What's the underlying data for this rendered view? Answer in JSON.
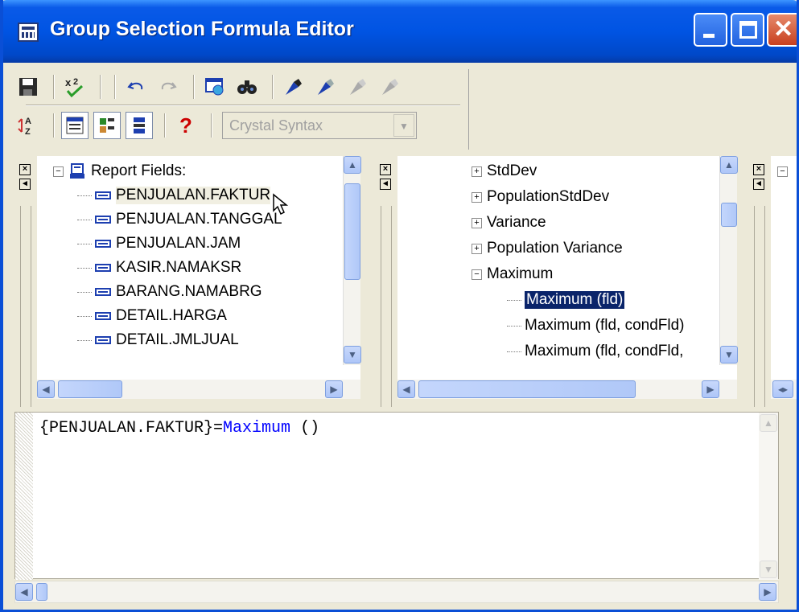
{
  "window": {
    "title": "Group Selection Formula Editor",
    "min_label": "",
    "max_label": "",
    "close_label": "✕"
  },
  "toolbar": {
    "syntax_combo": "Crystal Syntax",
    "icons": [
      "save-icon",
      "check-syntax-icon",
      "undo-icon",
      "redo-icon",
      "browse-data-icon",
      "find-icon",
      "bookmark-icon",
      "next-bookmark-icon",
      "prev-bookmark-icon",
      "clear-bookmarks-icon",
      "sort-az-icon",
      "field-tree-icon",
      "function-tree-icon",
      "operator-tree-icon",
      "help-icon"
    ]
  },
  "fields_tree": {
    "root": "Report Fields:",
    "items": [
      "PENJUALAN.FAKTUR",
      "PENJUALAN.TANGGAL",
      "PENJUALAN.JAM",
      "KASIR.NAMAKSR",
      "BARANG.NAMABRG",
      "DETAIL.HARGA",
      "DETAIL.JMLJUAL"
    ]
  },
  "functions_tree": {
    "items": [
      "StdDev",
      "PopulationStdDev",
      "Variance",
      "Population Variance",
      "Maximum"
    ],
    "children": [
      "Maximum (fld)",
      "Maximum (fld, condFld)",
      "Maximum (fld, condFld,"
    ]
  },
  "editor": {
    "code_field": "{PENJUALAN.FAKTUR}=",
    "code_keyword": "Maximum",
    "code_rest": " ()"
  }
}
